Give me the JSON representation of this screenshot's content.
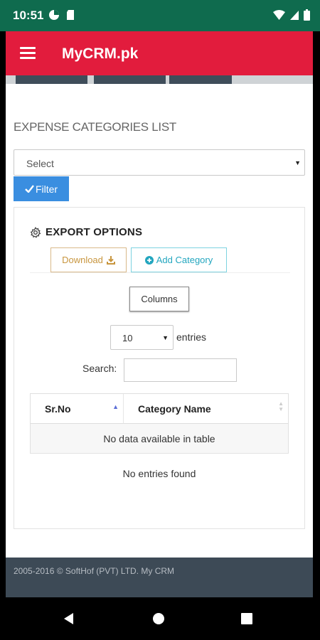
{
  "status_bar": {
    "time": "10:51"
  },
  "app_bar": {
    "title": "MyCRM.pk"
  },
  "page": {
    "title": "EXPENSE CATEGORIES LIST",
    "select_value": "Select",
    "filter_label": "Filter"
  },
  "export": {
    "heading": "EXPORT OPTIONS",
    "download_label": "Download",
    "add_category_label": "Add Category",
    "columns_label": "Columns"
  },
  "table_controls": {
    "page_length": "10",
    "entries_label": "entries",
    "search_label": "Search:",
    "search_value": ""
  },
  "table": {
    "columns": [
      "Sr.No",
      "Category Name"
    ],
    "empty_message": "No data available in table"
  },
  "info": {
    "text": "No entries found"
  },
  "footer": {
    "text": "2005-2016 © SoftHof (PVT) LTD. My CRM"
  },
  "colors": {
    "status_bar": "#0f6b4e",
    "app_bar": "#e21c3d",
    "filter_button": "#3a8ee0",
    "footer": "#3d4a56"
  }
}
